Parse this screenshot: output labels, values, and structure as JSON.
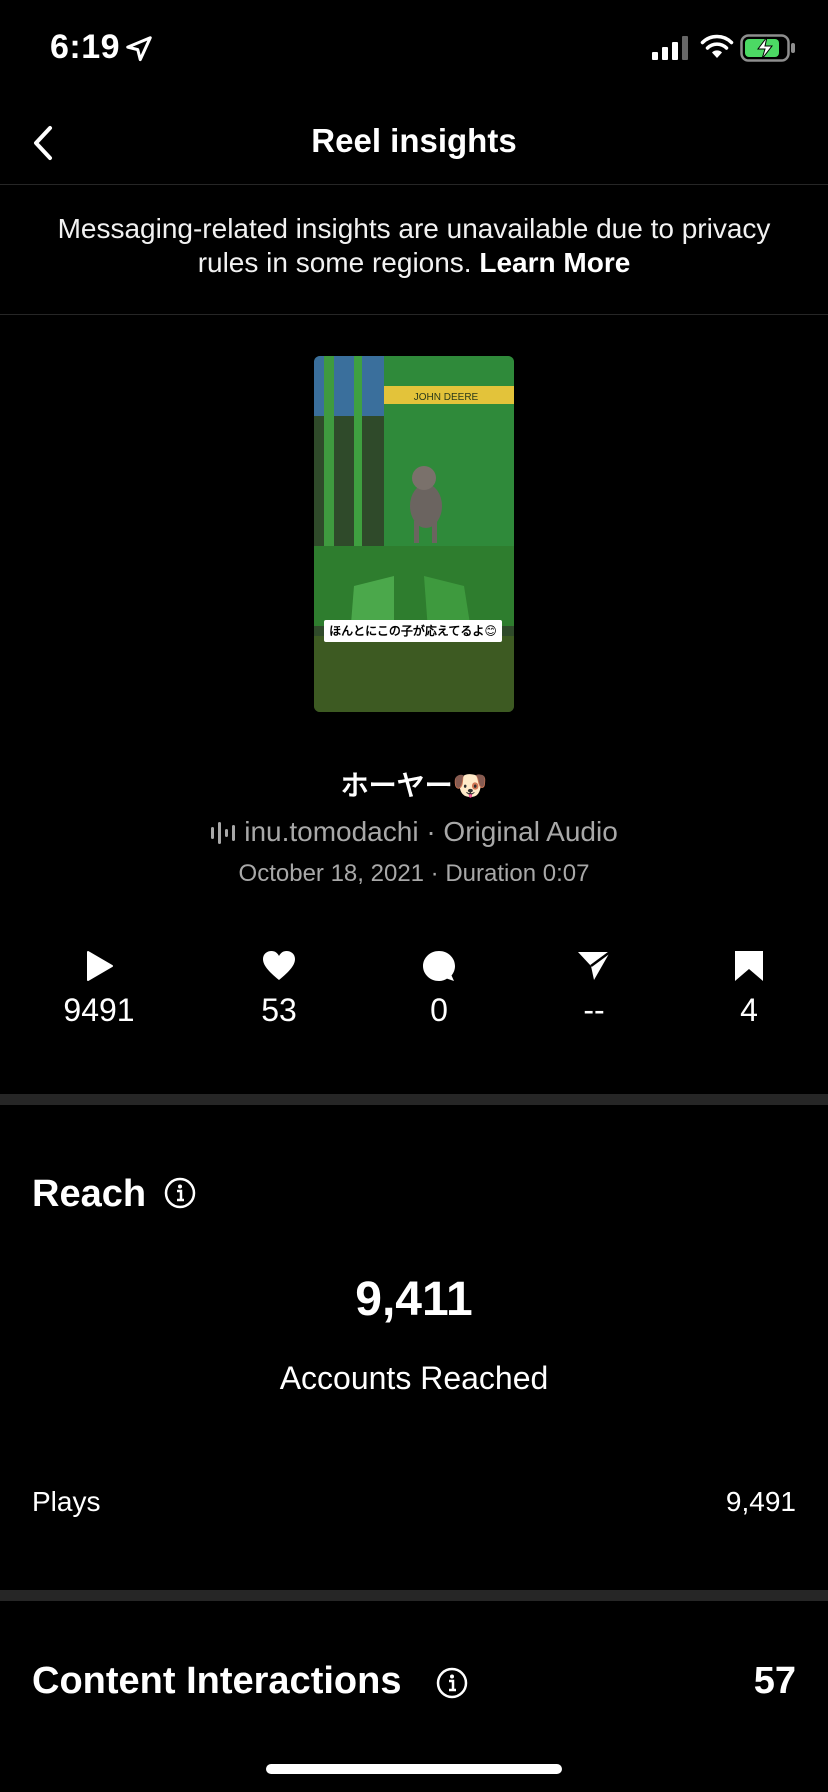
{
  "status_bar": {
    "time": "6:19"
  },
  "nav": {
    "title": "Reel insights"
  },
  "notice": {
    "text": "Messaging-related insights are unavailable due to privacy rules in some regions.",
    "link_label": "Learn More"
  },
  "reel": {
    "thumbnail_caption": "ほんとにこの子が応えてるよ😊",
    "thumbnail_sign": "JOHN DEERE",
    "title": "ホーヤー🐶",
    "audio": "inu.tomodachi · Original Audio",
    "meta": "October 18, 2021 · Duration 0:07"
  },
  "stats": {
    "plays": "9491",
    "likes": "53",
    "comments": "0",
    "shares": "--",
    "saves": "4"
  },
  "reach": {
    "title": "Reach",
    "accounts_reached_value": "9,411",
    "accounts_reached_label": "Accounts Reached",
    "plays_label": "Plays",
    "plays_value": "9,491"
  },
  "content_interactions": {
    "title": "Content Interactions",
    "value": "57"
  },
  "colors": {
    "background": "#000000",
    "divider": "#262626",
    "muted_text": "#a8a8a8",
    "battery_fill": "#4cd964"
  }
}
